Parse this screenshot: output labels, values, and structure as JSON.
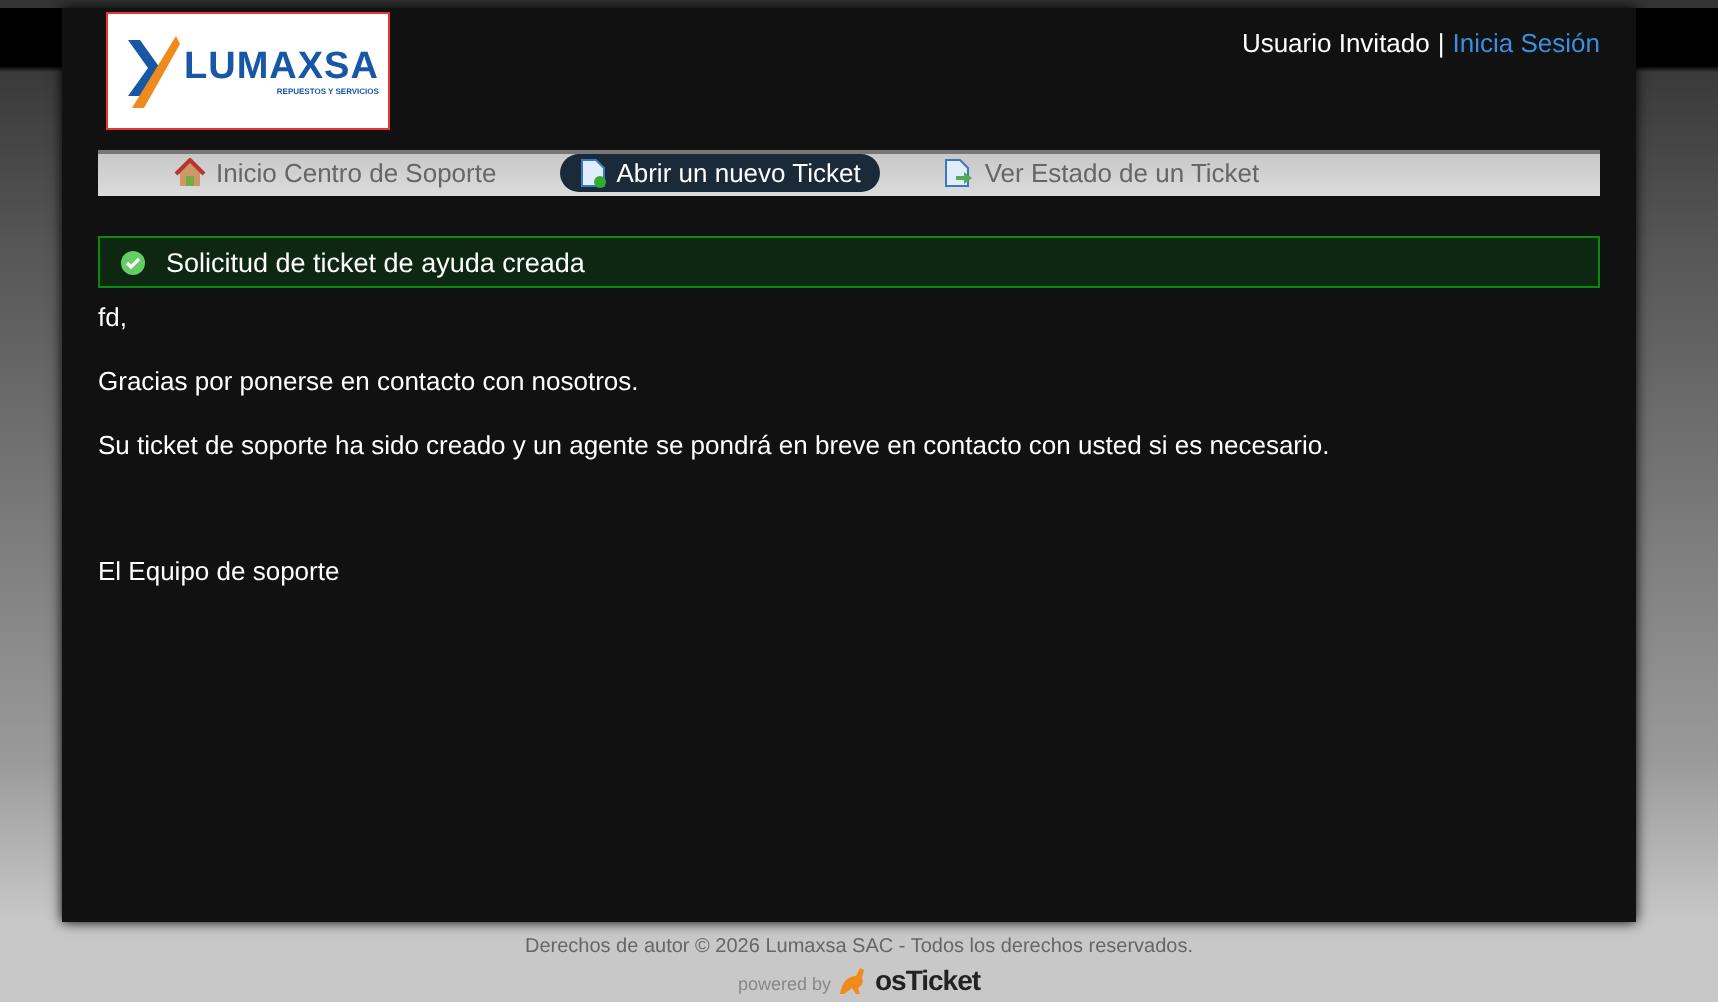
{
  "header": {
    "logo": {
      "name": "LUMAXSA",
      "tagline": "REPUESTOS Y SERVICIOS"
    },
    "user_bar": {
      "guest_label": "Usuario Invitado",
      "separator": "|",
      "login_link": "Inicia Sesión"
    }
  },
  "nav": [
    {
      "label": "Inicio Centro de Soporte",
      "kind": "home",
      "selected": false
    },
    {
      "label": "Abrir un nuevo Ticket",
      "kind": "new",
      "selected": true
    },
    {
      "label": "Ver Estado de un Ticket",
      "kind": "status",
      "selected": false
    }
  ],
  "notice": {
    "text": "Solicitud de ticket de ayuda creada"
  },
  "message": {
    "paragraphs": [
      "fd,",
      "Gracias por ponerse en contacto con nosotros.",
      "Su ticket de soporte ha sido creado y un agente se pondrá en breve en contacto con usted si es necesario."
    ],
    "signature": "El Equipo de soporte"
  },
  "footer": {
    "copyright": "Derechos de autor © 2026 Lumaxsa SAC - Todos los derechos reservados.",
    "powered_by": "powered by",
    "product": "osTicket"
  }
}
